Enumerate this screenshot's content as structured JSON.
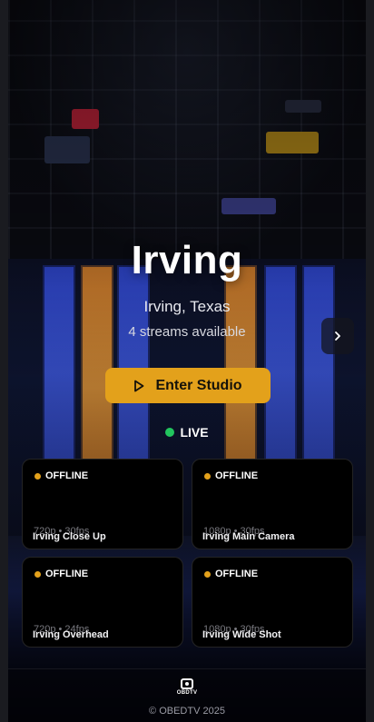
{
  "hero": {
    "title": "Irving",
    "location": "Irving, Texas",
    "streams_available": "4 streams available",
    "enter_label": "Enter Studio",
    "next_icon": "chevron-right-icon",
    "play_icon": "play-icon"
  },
  "live": {
    "label": "LIVE",
    "dot_color": "#22c55e"
  },
  "streams": [
    {
      "name": "Irving Close Up",
      "status": "OFFLINE",
      "meta": "720p • 30fps"
    },
    {
      "name": "Irving Main Camera",
      "status": "OFFLINE",
      "meta": "1080p • 30fps"
    },
    {
      "name": "Irving Overhead",
      "status": "OFFLINE",
      "meta": "720p • 24fps"
    },
    {
      "name": "Irving Wide Shot",
      "status": "OFFLINE",
      "meta": "1080p • 30fps"
    }
  ],
  "footer": {
    "logo_text": "OBDTV",
    "copyright": "© OBEDTV 2025"
  },
  "colors": {
    "accent": "#e3a11b",
    "offline_dot": "#e3a11b",
    "live_dot": "#22c55e"
  }
}
